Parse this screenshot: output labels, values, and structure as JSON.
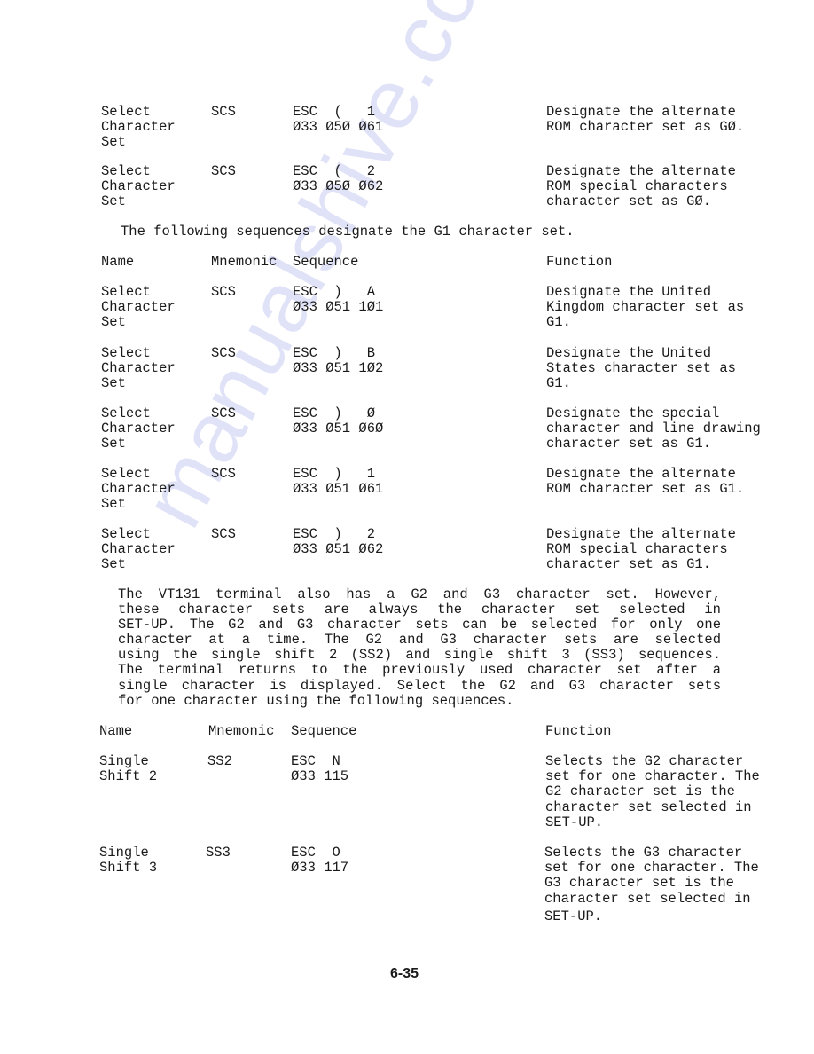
{
  "watermark": "manualshive.com",
  "g0_rows": [
    {
      "name": [
        "Select",
        "Character",
        "Set"
      ],
      "mnemonic": "SCS",
      "sequence": [
        "ESC  (   1",
        "Ø33 Ø5Ø Ø61"
      ],
      "function": [
        "Designate the alternate",
        "ROM character set as GØ."
      ]
    },
    {
      "name": [
        "Select",
        "Character",
        "Set"
      ],
      "mnemonic": "SCS",
      "sequence": [
        "ESC  (   2",
        "Ø33 Ø5Ø Ø62"
      ],
      "function": [
        "Designate the alternate",
        "ROM special characters",
        "character set as GØ."
      ]
    }
  ],
  "g1_intro": "The following sequences designate the G1 character set.",
  "table_headers": {
    "name": "Name",
    "mnemonic": "Mnemonic",
    "sequence": "Sequence",
    "function": "Function"
  },
  "g1_rows": [
    {
      "name": [
        "Select",
        "Character",
        "Set"
      ],
      "mnemonic": "SCS",
      "sequence": [
        "ESC  )   A",
        "Ø33 Ø51 1Ø1"
      ],
      "function": [
        "Designate the United",
        "Kingdom character set as",
        "G1."
      ]
    },
    {
      "name": [
        "Select",
        "Character",
        "Set"
      ],
      "mnemonic": "SCS",
      "sequence": [
        "ESC  )   B",
        "Ø33 Ø51 1Ø2"
      ],
      "function": [
        "Designate the United",
        "States character set as",
        "G1."
      ]
    },
    {
      "name": [
        "Select",
        "Character",
        "Set"
      ],
      "mnemonic": "SCS",
      "sequence": [
        "ESC  )   Ø",
        "Ø33 Ø51 Ø6Ø"
      ],
      "function": [
        "Designate the special",
        "character and line drawing",
        "character set as G1."
      ]
    },
    {
      "name": [
        "Select",
        "Character",
        "Set"
      ],
      "mnemonic": "SCS",
      "sequence": [
        "ESC  )   1",
        "Ø33 Ø51 Ø61"
      ],
      "function": [
        "Designate the alternate",
        "ROM character set as G1."
      ]
    },
    {
      "name": [
        "Select",
        "Character",
        "Set"
      ],
      "mnemonic": "SCS",
      "sequence": [
        "ESC  )   2",
        "Ø33 Ø51 Ø62"
      ],
      "function": [
        "Designate the alternate",
        "ROM special characters",
        "character set as G1."
      ]
    }
  ],
  "paragraph_lines": [
    "The VT131 terminal also has a G2 and G3 character set. However,",
    "these character sets are always the character set selected in",
    "SET-UP. The G2 and G3 character sets can be selected for only one",
    "character at a time. The G2 and G3 character sets are selected",
    "using the single shift 2 (SS2) and single shift 3 (SS3) sequences.",
    "The terminal returns to the previously used character set after a",
    "single character is displayed. Select the G2 and G3 character sets",
    "for one character using the following sequences."
  ],
  "ss_rows": [
    {
      "name": [
        "Single",
        "Shift 2"
      ],
      "mnemonic": "SS2",
      "sequence": [
        "ESC  N",
        "Ø33 115"
      ],
      "function": [
        "Selects the G2 character",
        "set for one character. The",
        "G2 character set is the",
        "character set selected in",
        "SET-UP."
      ]
    },
    {
      "name": [
        "Single",
        "Shift 3"
      ],
      "mnemonic": "SS3",
      "sequence": [
        "ESC  O",
        "Ø33 117"
      ],
      "function": [
        "Selects the G3 character",
        "set for one character. The",
        "G3 character set is the",
        "character set selected in",
        "SET-UP."
      ]
    }
  ],
  "page_number": "6-35"
}
